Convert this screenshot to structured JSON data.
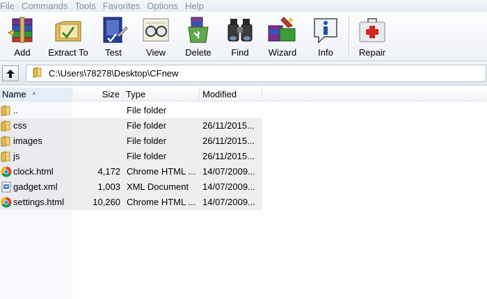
{
  "menu": [
    "File",
    "Commands",
    "Tools",
    "Favorites",
    "Options",
    "Help"
  ],
  "toolbar": [
    {
      "label": "Add",
      "icon": "add-archive-icon"
    },
    {
      "label": "Extract To",
      "icon": "extract-to-icon"
    },
    {
      "label": "Test",
      "icon": "test-icon"
    },
    {
      "label": "View",
      "icon": "view-icon"
    },
    {
      "label": "Delete",
      "icon": "delete-icon"
    },
    {
      "label": "Find",
      "icon": "find-binoculars-icon"
    },
    {
      "label": "Wizard",
      "icon": "wizard-icon"
    },
    {
      "label": "Info",
      "icon": "info-icon"
    },
    {
      "label": "Repair",
      "icon": "repair-first-aid-icon"
    }
  ],
  "address": {
    "path": "C:\\Users\\78278\\Desktop\\CFnew"
  },
  "columns": {
    "name": "Name",
    "size": "Size",
    "type": "Type",
    "modified": "Modified"
  },
  "files": [
    {
      "name": "..",
      "size": "",
      "type": "File folder",
      "modified": "",
      "icon": "folder"
    },
    {
      "name": "css",
      "size": "",
      "type": "File folder",
      "modified": "26/11/2015...",
      "icon": "folder"
    },
    {
      "name": "images",
      "size": "",
      "type": "File folder",
      "modified": "26/11/2015...",
      "icon": "folder"
    },
    {
      "name": "js",
      "size": "",
      "type": "File folder",
      "modified": "26/11/2015...",
      "icon": "folder"
    },
    {
      "name": "clock.html",
      "size": "4,172",
      "type": "Chrome HTML ...",
      "modified": "14/07/2009...",
      "icon": "chrome"
    },
    {
      "name": "gadget.xml",
      "size": "1,003",
      "type": "XML Document",
      "modified": "14/07/2009...",
      "icon": "xml"
    },
    {
      "name": "settings.html",
      "size": "10,260",
      "type": "Chrome HTML ...",
      "modified": "14/07/2009...",
      "icon": "chrome"
    }
  ]
}
